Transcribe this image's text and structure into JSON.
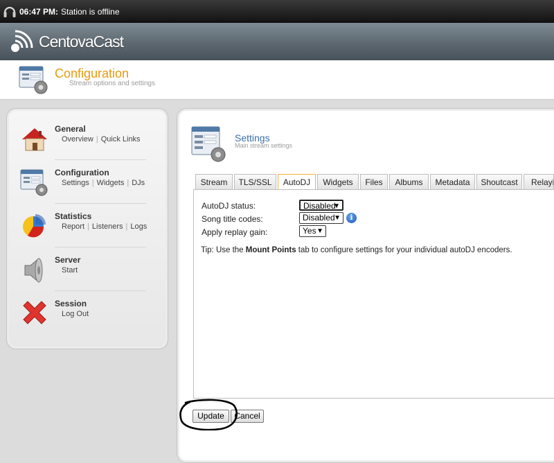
{
  "topbar": {
    "time": "06:47 PM:",
    "status": "Station is offline"
  },
  "brand": {
    "name": "CentovaCast"
  },
  "header": {
    "title": "Configuration",
    "subtitle": "Stream options and settings"
  },
  "sidebar": {
    "items": [
      {
        "name": "General",
        "links": [
          "Overview",
          "Quick Links"
        ]
      },
      {
        "name": "Configuration",
        "links": [
          "Settings",
          "Widgets",
          "DJs"
        ]
      },
      {
        "name": "Statistics",
        "links": [
          "Report",
          "Listeners",
          "Logs"
        ]
      },
      {
        "name": "Server",
        "links": [
          "Start"
        ]
      },
      {
        "name": "Session",
        "links": [
          "Log Out"
        ]
      }
    ]
  },
  "settings": {
    "title": "Settings",
    "subtitle": "Main stream settings",
    "tabs": [
      "Stream",
      "TLS/SSL",
      "AutoDJ",
      "Widgets",
      "Files",
      "Albums",
      "Metadata",
      "Shoutcast",
      "Relaying"
    ],
    "active_tab": "AutoDJ",
    "fields": [
      {
        "label": "AutoDJ status:",
        "value": "Disabled"
      },
      {
        "label": "Song title codes:",
        "value": "Disabled"
      },
      {
        "label": "Apply replay gain:",
        "value": "Yes"
      }
    ],
    "tip_prefix": "Tip: Use the ",
    "tip_bold": "Mount Points",
    "tip_suffix": " tab to configure settings for your individual autoDJ encoders.",
    "update_label": "Update",
    "cancel_label": "Cancel"
  },
  "icons": {
    "headphones": "headphones-icon",
    "logo": "broadcast-logo-icon",
    "info": "info-icon"
  }
}
